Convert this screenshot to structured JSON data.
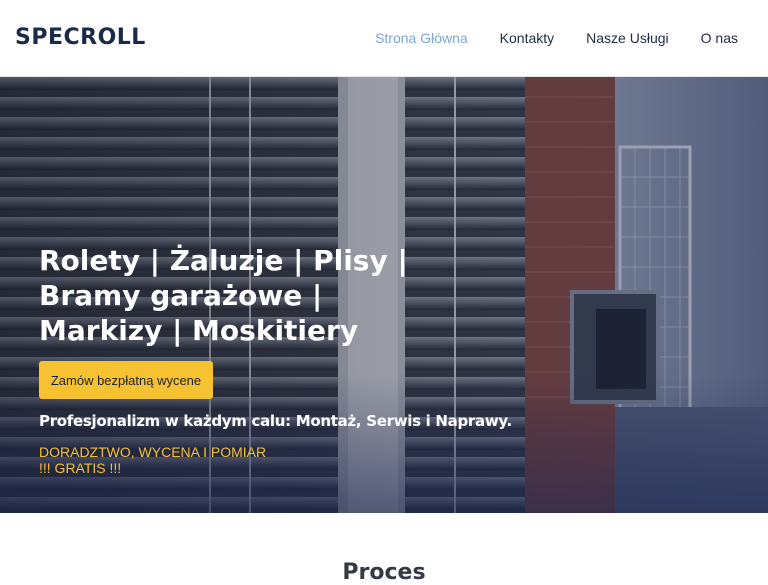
{
  "header": {
    "logo": "SPECROLL",
    "nav": [
      {
        "label": "Strona Główna",
        "active": true
      },
      {
        "label": "Kontakty",
        "active": false
      },
      {
        "label": "Nasze Usługi",
        "active": false
      },
      {
        "label": "O nas",
        "active": false
      }
    ]
  },
  "hero": {
    "title_lines": [
      "Rolety | Żaluzje | Plisy |",
      "Bramy garażowe |",
      "Markizy | Moskitiery"
    ],
    "cta_label": "Zamów bezpłatną wycene",
    "tagline": "Profesjonalizm w każdym calu: Montaż, Serwis i Naprawy.",
    "promo_lines": [
      "DORADZTWO, WYCENA I POMIAR",
      "!!! GRATIS !!!"
    ]
  },
  "process": {
    "heading": "Proces"
  },
  "colors": {
    "brand": "#1c2a4a",
    "active_nav": "#7da6d6",
    "cta": "#f6c231",
    "promo": "#f5c13a"
  }
}
